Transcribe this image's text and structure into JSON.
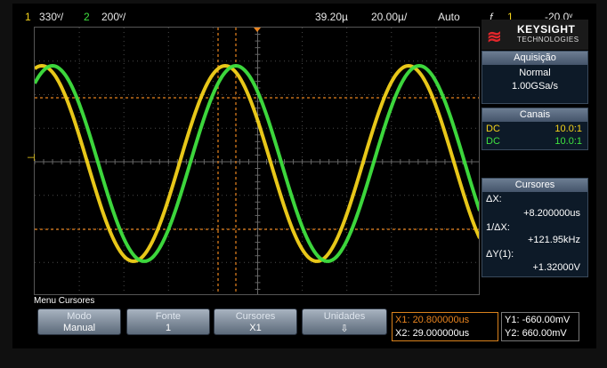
{
  "status_bar": {
    "ch1_num": "1",
    "ch1_scale": "330ᵛ/",
    "ch2_num": "2",
    "ch2_scale": "200ᵛ/",
    "delay": "39.20µ",
    "timebase": "20.00µ/",
    "trigger_mode": "Auto",
    "trigger_icon": "ƒ",
    "trigger_ch": "1",
    "trigger_level": "-20.0ᵛ"
  },
  "logo": {
    "brand": "KEYSIGHT",
    "sub": "TECHNOLOGIES"
  },
  "acquisition": {
    "title": "Aquisição",
    "mode": "Normal",
    "rate": "1.00GSa/s"
  },
  "channels": {
    "title": "Canais",
    "rows": [
      {
        "coupling": "DC",
        "probe": "10.0:1"
      },
      {
        "coupling": "DC",
        "probe": "10.0:1"
      }
    ]
  },
  "cursors": {
    "title": "Cursores",
    "dx_label": "ΔX:",
    "dx_value": "+8.200000us",
    "inv_dx_label": "1/ΔX:",
    "inv_dx_value": "+121.95kHz",
    "dy_label": "ΔY(1):",
    "dy_value": "+1.32000V"
  },
  "menu": {
    "title": "Menu Cursores",
    "softkeys": [
      {
        "label": "Modo",
        "value": "Manual"
      },
      {
        "label": "Fonte",
        "value": "1"
      },
      {
        "label": "Cursores",
        "value": "X1"
      },
      {
        "label": "Unidades",
        "value": "⇩"
      }
    ],
    "x1": "X1: 20.800000us",
    "x2": "X2: 29.000000us",
    "y1": "Y1: -660.00mV",
    "y2": "Y2: 660.00mV"
  },
  "colors": {
    "ch1": "#f4d21a",
    "ch2": "#3fe23f",
    "cursor": "#e8841f",
    "grid": "#4a4a4a"
  },
  "icons": {
    "logo_mark": "keysight-wave-logo",
    "trigger": "trigger-edge-icon",
    "ground_marker": "channel-ground-marker-icon"
  }
}
